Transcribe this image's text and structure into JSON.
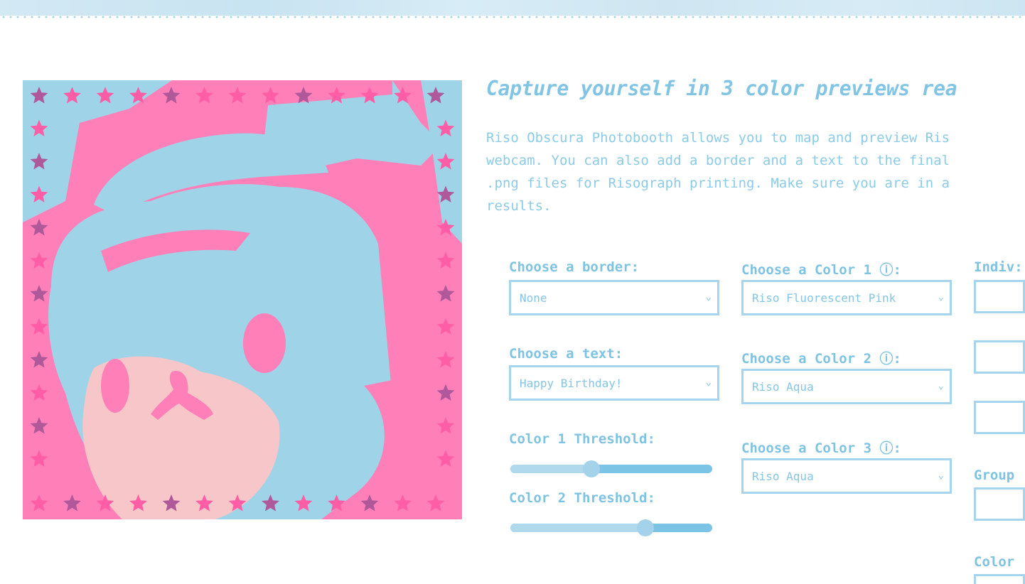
{
  "header": {
    "headline": "Capture yourself in 3 color previews rea",
    "description_lines": [
      "Riso Obscura Photobooth allows you to map and preview Ris",
      "webcam. You can also add a border and a text to the final",
      ".png files for Risograph printing. Make sure you are in a",
      "results."
    ]
  },
  "controls": {
    "border": {
      "label": "Choose a border:",
      "value": "None"
    },
    "text": {
      "label": "Choose a text:",
      "value": "Happy Birthday!"
    },
    "threshold1": {
      "label": "Color 1 Threshold:",
      "value": 0.4
    },
    "threshold2": {
      "label": "Color 2 Threshold:",
      "value": 0.67
    },
    "color1": {
      "label": "Choose a Color 1 ⓘ:",
      "value": "Riso Fluorescent Pink"
    },
    "color2": {
      "label": "Choose a Color 2 ⓘ:",
      "value": "Riso Aqua"
    },
    "color3": {
      "label": "Choose a Color 3 ⓘ:",
      "value": "Riso Aqua"
    },
    "individual_label": "Indiv:",
    "group_label": "Group",
    "color_label": "Color"
  },
  "preview": {
    "ink_colors": {
      "pink": "#ff7fb8",
      "aqua": "#9fd3e8",
      "peach": "#f7c6c8",
      "star": "#ff5ea7",
      "star_dark": "#b0599a"
    }
  },
  "icons": {
    "chevron": "chevron-down-icon",
    "star": "star-icon"
  }
}
